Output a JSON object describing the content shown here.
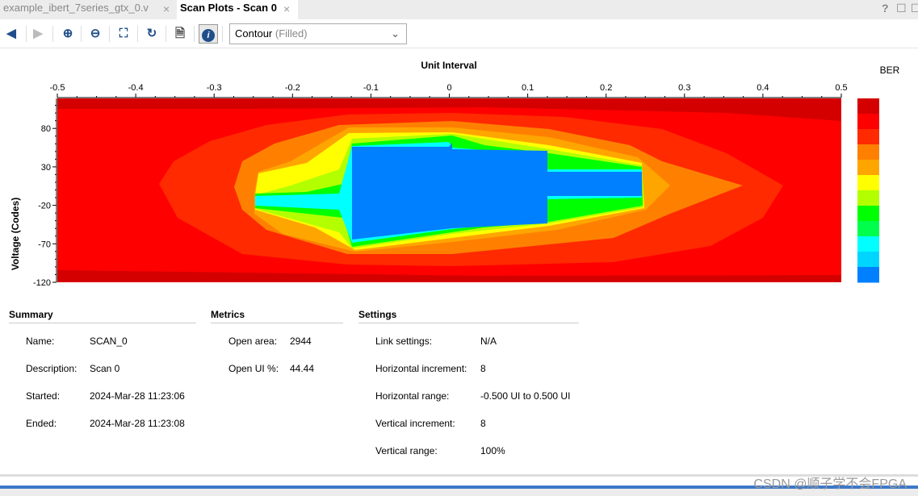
{
  "tabs": [
    {
      "label": "example_ibert_7series_gtx_0.v",
      "active": false
    },
    {
      "label": "Scan Plots - Scan 0",
      "active": true
    }
  ],
  "close_glyph": "×",
  "window_buttons": {
    "help": "?",
    "restore": "☐",
    "maximize": "☐"
  },
  "toolbar": {
    "icons": [
      "back-arrow-icon",
      "forward-arrow-icon",
      "zoom-in-icon",
      "zoom-out-icon",
      "fit-icon",
      "refresh-icon",
      "export-icon",
      "info-icon"
    ],
    "plot_type": "Contour",
    "plot_type_variant": "(Filled)"
  },
  "chart_data": {
    "type": "heatmap",
    "title": "Unit Interval",
    "xlabel": "Unit Interval",
    "ylabel": "Voltage (Codes)",
    "xlim": [
      -0.5,
      0.5
    ],
    "ylim": [
      -120,
      119
    ],
    "x_ticks": [
      "-0.5",
      "-0.4",
      "-0.3",
      "-0.2",
      "-0.1",
      "0",
      "0.1",
      "0.2",
      "0.3",
      "0.4",
      "0.5"
    ],
    "y_ticks": [
      "80",
      "30",
      "-20",
      "-70",
      "-120"
    ],
    "legend_title": "BER",
    "colorbar": [
      "#d40000",
      "#ff0000",
      "#ff2a00",
      "#ff8000",
      "#ffa500",
      "#ffff00",
      "#b3ff00",
      "#00ff00",
      "#00ff4d",
      "#00ffff",
      "#00d5ff",
      "#0080ff"
    ],
    "eye_opening": {
      "x_range": [
        -0.125,
        0.125
      ],
      "y_range": [
        -70,
        60
      ],
      "wide_region_x": [
        -0.125,
        0.25
      ],
      "wide_region_y": [
        -35,
        30
      ]
    }
  },
  "summary": {
    "title": "Summary",
    "rows": [
      {
        "label": "Name:",
        "value": "SCAN_0"
      },
      {
        "label": "Description:",
        "value": "Scan 0"
      },
      {
        "label": "Started:",
        "value": "2024-Mar-28 11:23:06"
      },
      {
        "label": "Ended:",
        "value": "2024-Mar-28 11:23:08"
      }
    ]
  },
  "metrics": {
    "title": "Metrics",
    "rows": [
      {
        "label": "Open area:",
        "value": "2944"
      },
      {
        "label": "Open UI %:",
        "value": "44.44"
      }
    ]
  },
  "settings": {
    "title": "Settings",
    "rows": [
      {
        "label": "Link settings:",
        "value": "N/A"
      },
      {
        "label": "Horizontal increment:",
        "value": "8"
      },
      {
        "label": "Horizontal range:",
        "value": "-0.500 UI to 0.500 UI"
      },
      {
        "label": "Vertical increment:",
        "value": "8"
      },
      {
        "label": "Vertical range:",
        "value": "100%"
      }
    ]
  },
  "watermark": "CSDN @顺子学不会FPGA"
}
